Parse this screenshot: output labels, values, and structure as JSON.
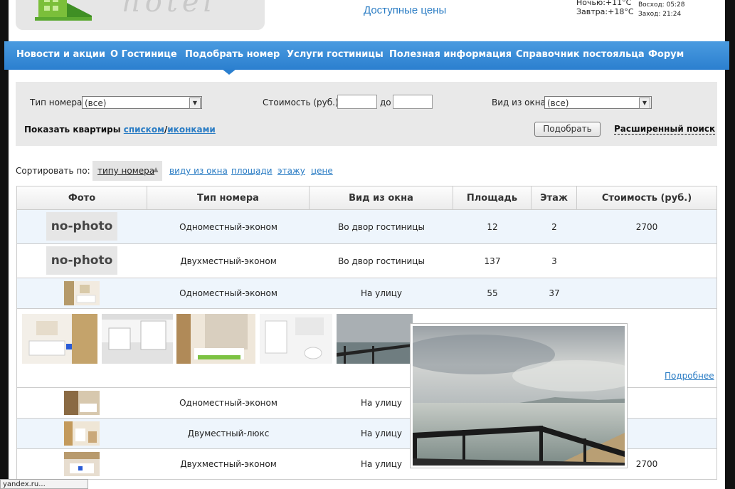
{
  "header": {
    "tagline": "Доступные цены",
    "weather_night": "Ночью:+11°C",
    "weather_tomorrow": "Завтра:+18°C",
    "sunrise": "Восход: 05:28",
    "sunset": "Заход: 21:24"
  },
  "nav": {
    "items": [
      "Новости и акции",
      "О Гостинице",
      "Подобрать номер",
      "Услуги гостиницы",
      "Полезная информация",
      "Справочник постояльца",
      "Форум"
    ]
  },
  "filter": {
    "room_type_label": "Тип номера",
    "room_type_value": "(все)",
    "price_label": "Стоимость (руб.)",
    "price_to_label": "до",
    "view_label": "Вид из окна",
    "view_value": "(все)",
    "show_label": "Показать квартиры",
    "show_list": "списком",
    "show_sep": "/",
    "show_icons": "иконками",
    "submit_label": "Подобрать",
    "advanced_label": "Расширенный поиск"
  },
  "sort": {
    "label": "Сортировать по:",
    "active": "типу номера",
    "options": [
      "виду из окна",
      "площади",
      "этажу",
      "цене"
    ]
  },
  "table": {
    "headers": [
      "Фото",
      "Тип номера",
      "Вид из окна",
      "Площадь",
      "Этаж",
      "Стоимость (руб.)"
    ],
    "nophoto_label": "no-photo",
    "rows": [
      {
        "type": "Одноместный-эконом",
        "view": "Во двор гостиницы",
        "area": "12",
        "floor": "2",
        "price": "2700"
      },
      {
        "type": "Двухместный-эконом",
        "view": "Во двор гостиницы",
        "area": "137",
        "floor": "3",
        "price": ""
      },
      {
        "type": "Одноместный-эконом",
        "view": "На улицу",
        "area": "55",
        "floor": "37",
        "price": ""
      },
      {
        "type": "Одноместный-эконом",
        "view": "На улицу",
        "area": "",
        "floor": "",
        "price": ""
      },
      {
        "type": "Двуместный-люкс",
        "view": "На улицу",
        "area": "",
        "floor": "",
        "price": ""
      },
      {
        "type": "Двухместный-эконом",
        "view": "На улицу",
        "area": "",
        "floor": "",
        "price": "2700"
      }
    ],
    "more_label": "Подробнее"
  },
  "status": "yandex.ru..."
}
